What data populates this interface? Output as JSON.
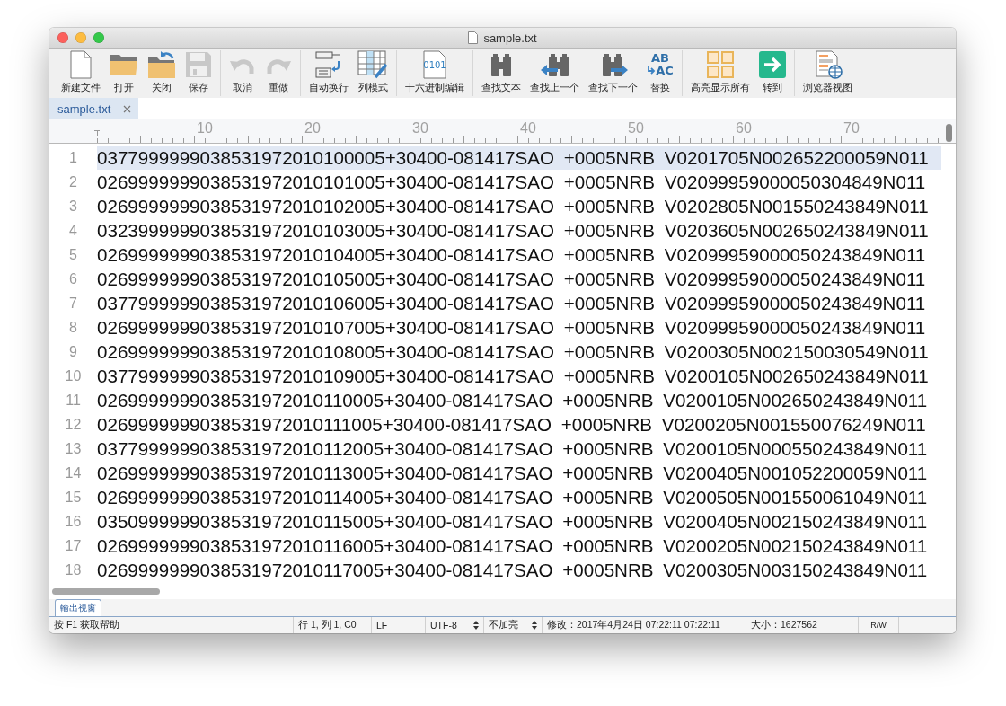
{
  "window": {
    "title": "sample.txt"
  },
  "toolbar": {
    "groups": [
      [
        {
          "label": "新建文件",
          "disabled": false
        },
        {
          "label": "打开",
          "disabled": false
        },
        {
          "label": "关闭",
          "disabled": false
        },
        {
          "label": "保存",
          "disabled": true
        }
      ],
      [
        {
          "label": "取消",
          "disabled": true
        },
        {
          "label": "重做",
          "disabled": true
        }
      ],
      [
        {
          "label": "自动换行",
          "disabled": false
        },
        {
          "label": "列模式",
          "disabled": false
        }
      ],
      [
        {
          "label": "十六进制编辑",
          "icon_text": "0101",
          "disabled": false
        }
      ],
      [
        {
          "label": "查找文本",
          "disabled": false
        },
        {
          "label": "查找上一个",
          "disabled": false
        },
        {
          "label": "查找下一个",
          "disabled": false
        },
        {
          "label": "替换",
          "icon_text": "AB AC",
          "disabled": false
        }
      ],
      [
        {
          "label": "高亮显示所有",
          "disabled": false
        },
        {
          "label": "转到",
          "disabled": false
        }
      ],
      [
        {
          "label": "浏览器视图",
          "disabled": false
        }
      ]
    ]
  },
  "tabs": [
    {
      "label": "sample.txt",
      "selected": true
    }
  ],
  "ruler": {
    "labels": [
      "10",
      "20",
      "30",
      "40",
      "50",
      "60",
      "70"
    ]
  },
  "editor": {
    "lines": [
      {
        "number": "1",
        "text": "0377999999038531972010100005+30400-081417SAO +0005NRB V0201705N002652200059N011",
        "current": true
      },
      {
        "number": "2",
        "text": "0269999999038531972010101005+30400-081417SAO +0005NRB V02099959000050304849N011",
        "current": false
      },
      {
        "number": "3",
        "text": "0269999999038531972010102005+30400-081417SAO +0005NRB V0202805N001550243849N011",
        "current": false
      },
      {
        "number": "4",
        "text": "0323999999038531972010103005+30400-081417SAO +0005NRB V0203605N002650243849N011",
        "current": false
      },
      {
        "number": "5",
        "text": "0269999999038531972010104005+30400-081417SAO +0005NRB V02099959000050243849N011",
        "current": false
      },
      {
        "number": "6",
        "text": "0269999999038531972010105005+30400-081417SAO +0005NRB V02099959000050243849N011",
        "current": false
      },
      {
        "number": "7",
        "text": "0377999999038531972010106005+30400-081417SAO +0005NRB V02099959000050243849N011",
        "current": false
      },
      {
        "number": "8",
        "text": "0269999999038531972010107005+30400-081417SAO +0005NRB V02099959000050243849N011",
        "current": false
      },
      {
        "number": "9",
        "text": "0269999999038531972010108005+30400-081417SAO +0005NRB V0200305N002150030549N011",
        "current": false
      },
      {
        "number": "10",
        "text": "0377999999038531972010109005+30400-081417SAO +0005NRB V0200105N002650243849N011",
        "current": false
      },
      {
        "number": "11",
        "text": "0269999999038531972010110005+30400-081417SAO +0005NRB V0200105N002650243849N011",
        "current": false
      },
      {
        "number": "12",
        "text": "0269999999038531972010111005+30400-081417SAO +0005NRB V0200205N001550076249N011",
        "current": false
      },
      {
        "number": "13",
        "text": "0377999999038531972010112005+30400-081417SAO +0005NRB V0200105N000550243849N011",
        "current": false
      },
      {
        "number": "14",
        "text": "0269999999038531972010113005+30400-081417SAO +0005NRB V0200405N001052200059N011",
        "current": false
      },
      {
        "number": "15",
        "text": "0269999999038531972010114005+30400-081417SAO +0005NRB V0200505N001550061049N011",
        "current": false
      },
      {
        "number": "16",
        "text": "0350999999038531972010115005+30400-081417SAO +0005NRB V0200405N002150243849N011",
        "current": false
      },
      {
        "number": "17",
        "text": "0269999999038531972010116005+30400-081417SAO +0005NRB V0200205N002150243849N011",
        "current": false
      },
      {
        "number": "18",
        "text": "0269999999038531972010117005+30400-081417SAO +0005NRB V0200305N003150243849N011",
        "current": false
      }
    ]
  },
  "panel_tabs": [
    {
      "label": "輸出視窗",
      "selected": true
    }
  ],
  "status_bar": {
    "help": "按 F1 获取帮助",
    "position": "行 1, 列 1, C0",
    "line_ending": "LF",
    "encoding": "UTF-8",
    "highlight": "不加亮",
    "modified": "修改：2017年4月24日 07:22:11 07:22:11",
    "size": "大小：1627562",
    "mode": "R/W"
  }
}
